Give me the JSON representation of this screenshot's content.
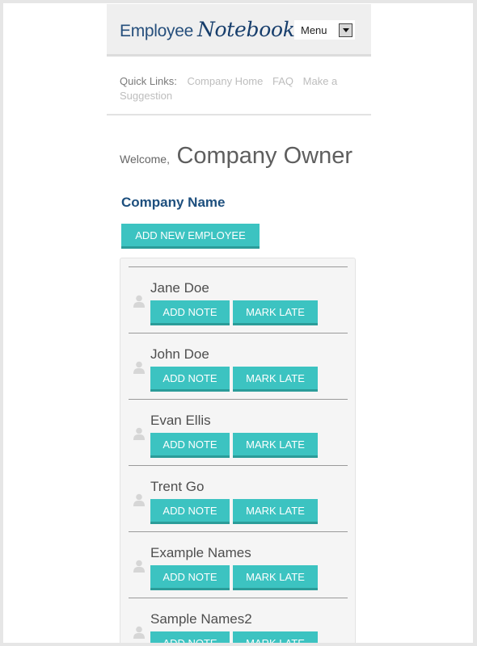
{
  "header": {
    "logo_prefix": "Employee",
    "logo_script": "Notebook",
    "menu_label": "Menu"
  },
  "quick_links": {
    "label": "Quick Links:",
    "links": [
      "Company Home",
      "FAQ",
      "Make a Suggestion"
    ]
  },
  "welcome": {
    "greeting": "Welcome,",
    "name": "Company Owner"
  },
  "company_name": "Company Name",
  "add_employee_label": "ADD NEW EMPLOYEE",
  "employees": [
    {
      "name": "Jane Doe",
      "add_note": "ADD NOTE",
      "mark_late": "MARK LATE"
    },
    {
      "name": "John Doe",
      "add_note": "ADD NOTE",
      "mark_late": "MARK LATE"
    },
    {
      "name": "Evan Ellis",
      "add_note": "ADD NOTE",
      "mark_late": "MARK LATE"
    },
    {
      "name": "Trent Go",
      "add_note": "ADD NOTE",
      "mark_late": "MARK LATE"
    },
    {
      "name": "Example Names",
      "add_note": "ADD NOTE",
      "mark_late": "MARK LATE"
    },
    {
      "name": "Sample Names2",
      "add_note": "ADD NOTE",
      "mark_late": "MARK LATE"
    }
  ],
  "colors": {
    "accent": "#3cc3c1",
    "accent_shadow": "#2b9c99",
    "brand": "#264f7c"
  },
  "icons": {
    "avatar": "person-icon",
    "menu_arrow": "chevron-down-icon"
  }
}
